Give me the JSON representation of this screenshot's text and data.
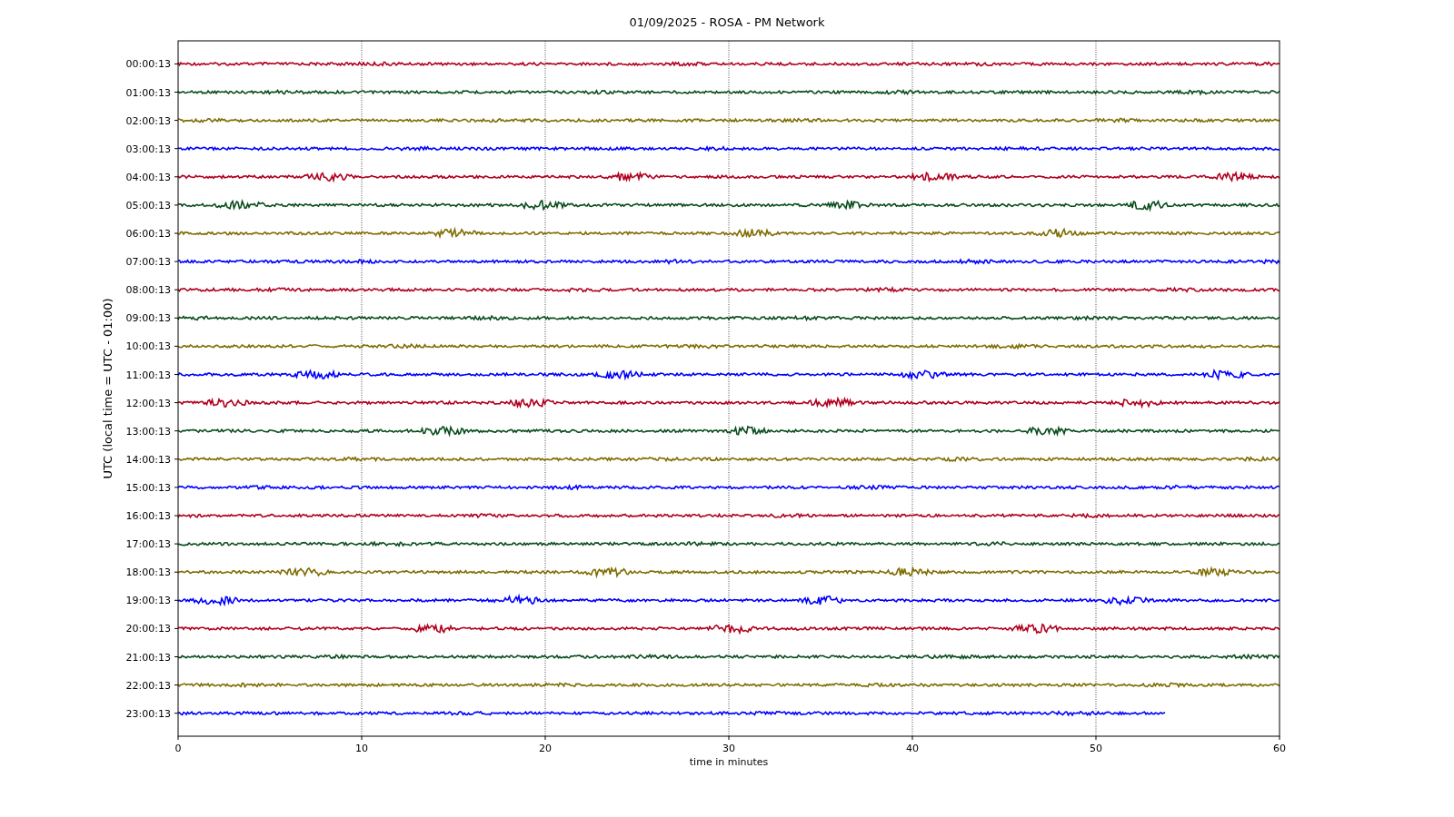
{
  "title": "01/09/2025 - ROSA - PM Network",
  "chart": {
    "xlabel": "time in minutes",
    "ylabel": "UTC (local time = UTC - 01:00)",
    "xticks": [
      "0",
      "10",
      "20",
      "30",
      "40",
      "50",
      "60"
    ],
    "traces": [
      {
        "label": "00:00:13",
        "color": "#b0001e",
        "level": 1
      },
      {
        "label": "01:00:13",
        "color": "#0a4d1c",
        "level": 1
      },
      {
        "label": "02:00:13",
        "color": "#7f6c00",
        "level": 1
      },
      {
        "label": "03:00:13",
        "color": "#0000ff",
        "level": 1
      },
      {
        "label": "04:00:13",
        "color": "#b0001e",
        "level": 1
      },
      {
        "label": "05:00:13",
        "color": "#0a4d1c",
        "level": 1
      },
      {
        "label": "06:00:13",
        "color": "#7f6c00",
        "level": 1
      },
      {
        "label": "07:00:13",
        "color": "#0000ff",
        "level": 1
      },
      {
        "label": "08:00:13",
        "color": "#b0001e",
        "level": 1
      },
      {
        "label": "09:00:13",
        "color": "#0a4d1c",
        "level": 1
      },
      {
        "label": "10:00:13",
        "color": "#7f6c00",
        "level": 1
      },
      {
        "label": "11:00:13",
        "color": "#0000ff",
        "level": 1
      },
      {
        "label": "12:00:13",
        "color": "#b0001e",
        "level": 1
      },
      {
        "label": "13:00:13",
        "color": "#0a4d1c",
        "level": 1
      },
      {
        "label": "14:00:13",
        "color": "#7f6c00",
        "level": 1
      },
      {
        "label": "15:00:13",
        "color": "#0000ff",
        "level": 1
      },
      {
        "label": "16:00:13",
        "color": "#b0001e",
        "level": 1
      },
      {
        "label": "17:00:13",
        "color": "#0a4d1c",
        "level": 1
      },
      {
        "label": "18:00:13",
        "color": "#7f6c00",
        "level": 1
      },
      {
        "label": "19:00:13",
        "color": "#0000ff",
        "level": 1
      },
      {
        "label": "20:00:13",
        "color": "#b0001e",
        "level": 1
      },
      {
        "label": "21:00:13",
        "color": "#0a4d1c",
        "level": 1
      },
      {
        "label": "22:00:13",
        "color": "#7f6c00",
        "level": 1
      },
      {
        "label": "23:00:13",
        "color": "#0000ff",
        "level": 0.897
      }
    ]
  }
}
